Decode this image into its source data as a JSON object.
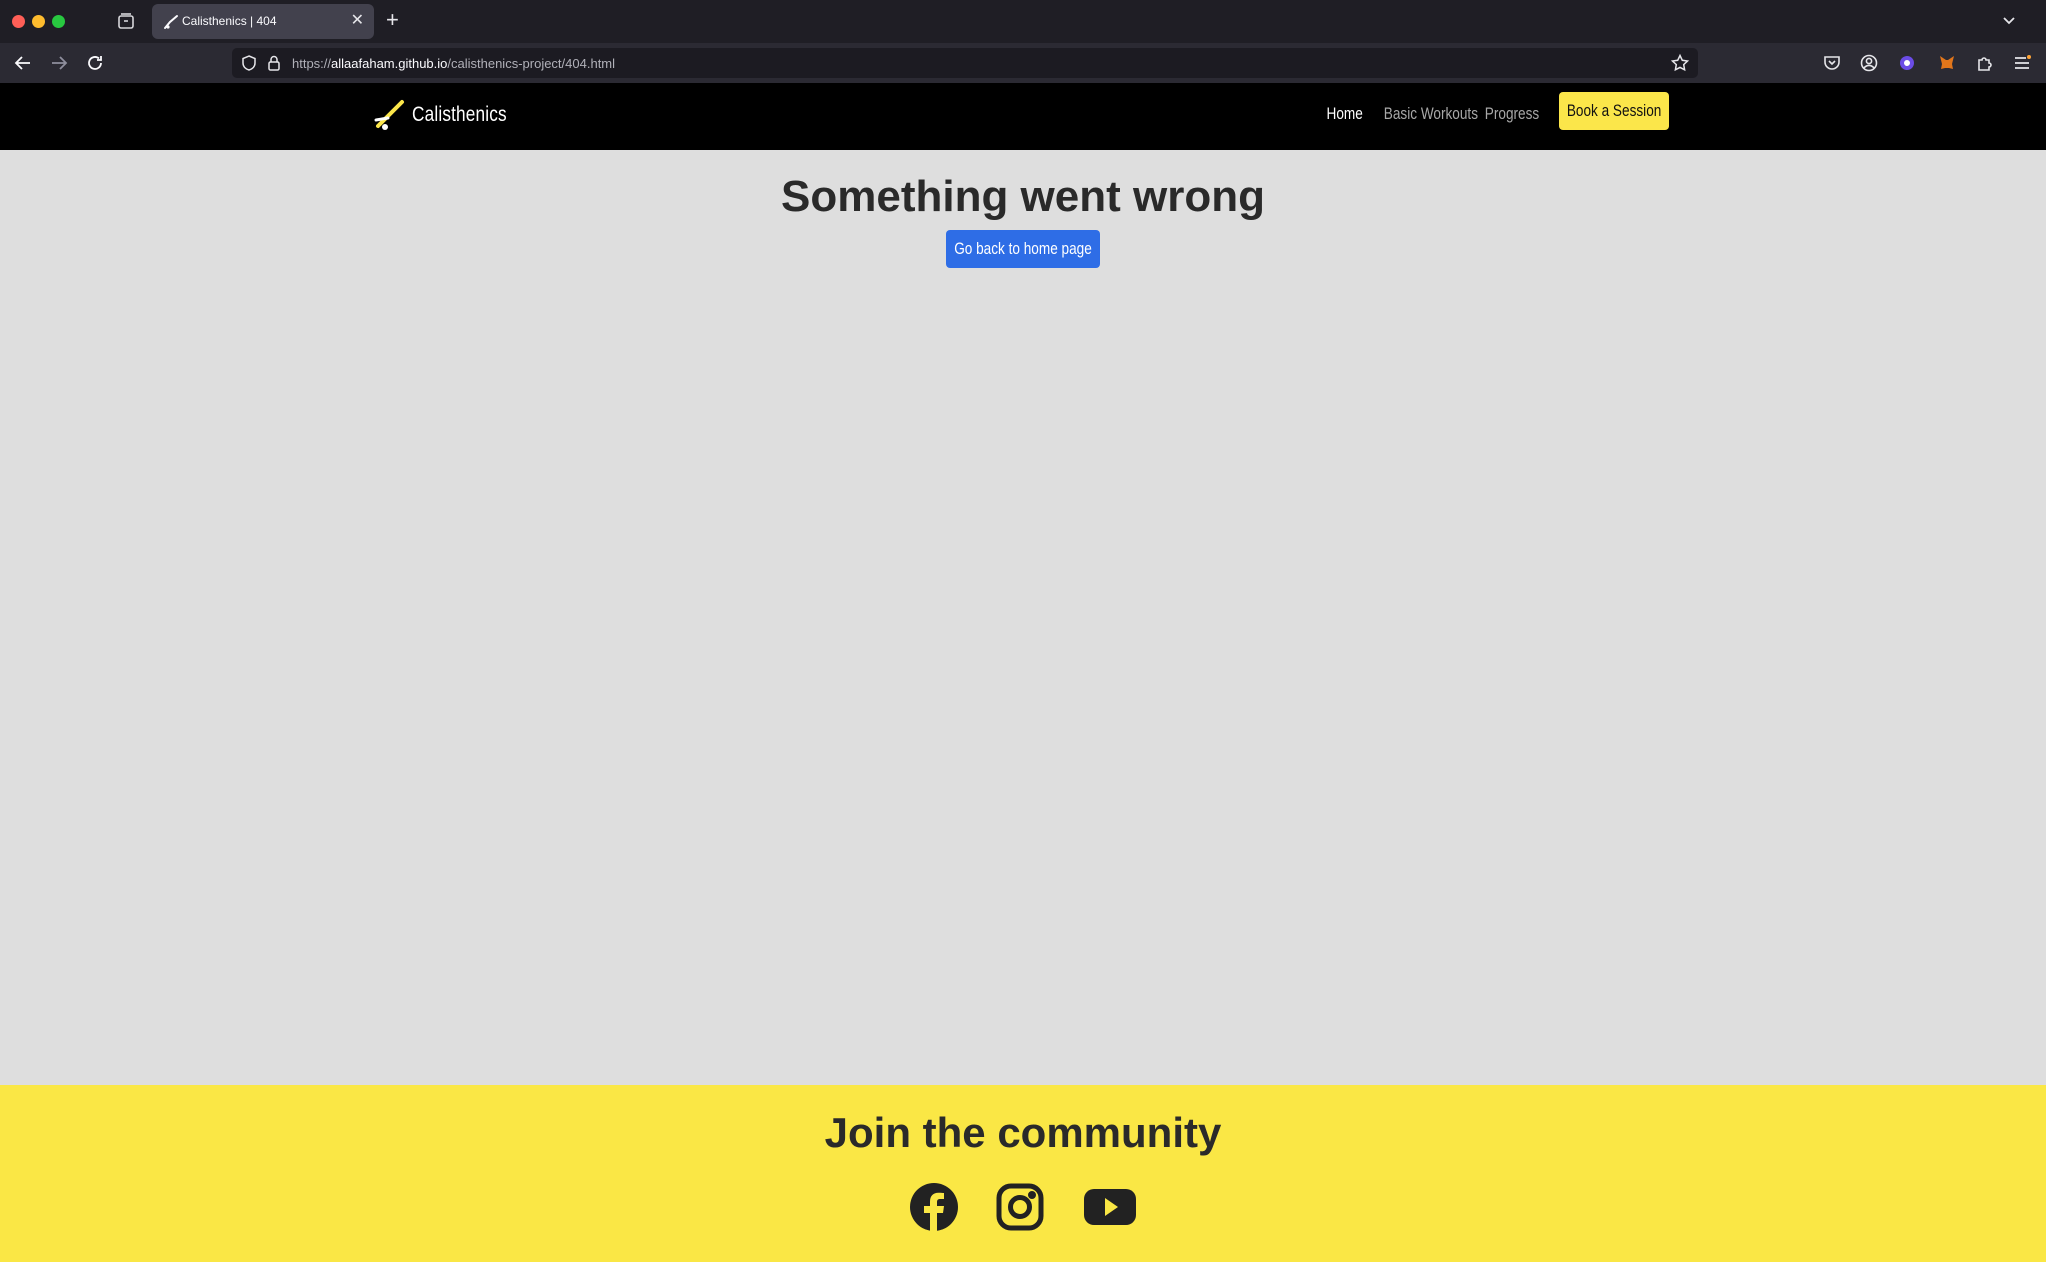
{
  "browser": {
    "tab_title": "Calisthenics | 404",
    "url_prefix": "https://",
    "url_domain": "allaafaham.github.io",
    "url_path": "/calisthenics-project/404.html"
  },
  "site": {
    "brand": "Calisthenics",
    "nav": {
      "home": "Home",
      "basic_workouts": "Basic Workouts",
      "progress": "Progress",
      "book": "Book a Session"
    },
    "colors": {
      "header_bg": "#000000",
      "accent_yellow": "#fbe64a",
      "button_blue": "#2e6de6",
      "page_bg": "#dedede"
    }
  },
  "main": {
    "title": "Something went wrong",
    "home_button": "Go back to home page"
  },
  "footer": {
    "title": "Join the community",
    "social": [
      "facebook-icon",
      "instagram-icon",
      "youtube-icon"
    ]
  }
}
